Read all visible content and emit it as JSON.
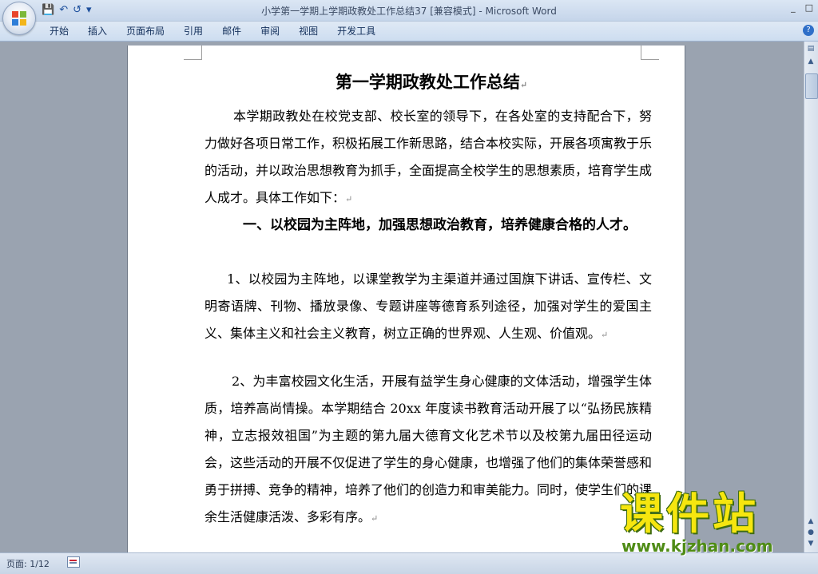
{
  "window": {
    "title": "小学第一学期上学期政教处工作总结37 [兼容模式] - Microsoft Word",
    "controls": [
      "_",
      "□"
    ]
  },
  "qat": {
    "save_icon": "💾",
    "undo_icon": "↶",
    "redo_icon": "↺",
    "customize_icon": "▾"
  },
  "ribbon": {
    "tabs": [
      "开始",
      "插入",
      "页面布局",
      "引用",
      "邮件",
      "审阅",
      "视图",
      "开发工具"
    ],
    "help_label": "?"
  },
  "document": {
    "title": "第一学期政教处工作总结",
    "pilcrow": "↵",
    "paragraphs": [
      "本学期政教处在校党支部、校长室的领导下，在各处室的支持配合下，努力做好各项日常工作，积极拓展工作新思路，结合本校实际，开展各项寓教于乐的活动，并以政治思想教育为抓手，全面提高全校学生的思想素质，培育学生成人成才。具体工作如下：",
      "一、以校园为主阵地，加强思想政治教育，培养健康合格的人才。",
      "1、以校园为主阵地，以课堂教学为主渠道并通过国旗下讲话、宣传栏、文明寄语牌、刊物、播放录像、专题讲座等德育系列途径，加强对学生的爱国主义、集体主义和社会主义教育，树立正确的世界观、人生观、价值观。",
      "2、为丰富校园文化生活，开展有益学生身心健康的文体活动，增强学生体质，培养高尚情操。本学期结合 20xx 年度读书教育活动开展了以“弘扬民族精神，立志报效祖国”为主题的第九届大德育文化艺术节以及校第九届田径运动会，这些活动的开展不仅促进了学生的身心健康，也增强了他们的集体荣誉感和勇于拼搏、竞争的精神，培养了他们的创造力和审美能力。同时，使学生们的课余生活健康活泼、多彩有序。"
    ]
  },
  "status": {
    "page": "页面: 1/12"
  },
  "watermark": {
    "cn": "课件站",
    "url": "www.kjzhan.com"
  }
}
